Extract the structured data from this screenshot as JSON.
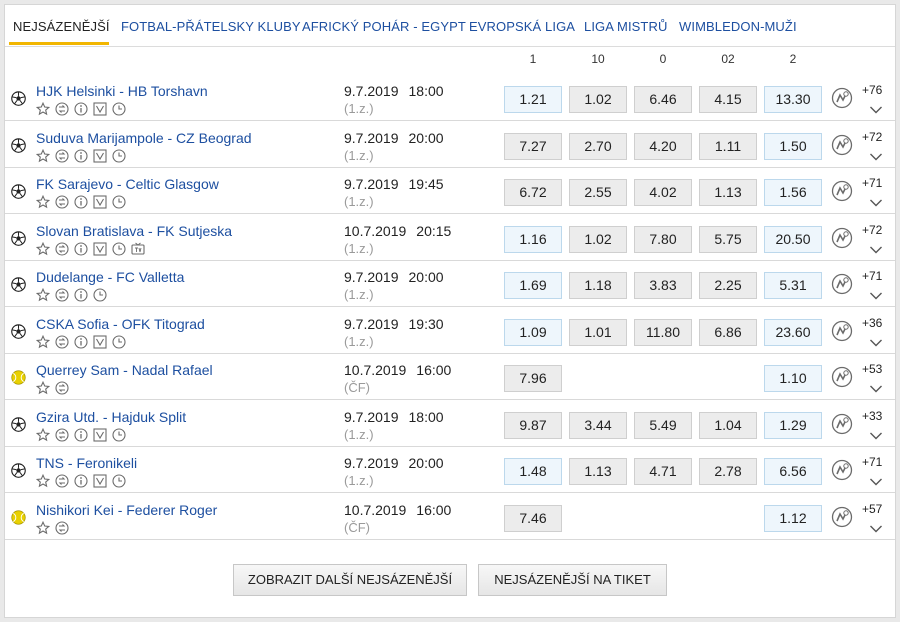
{
  "tabs": [
    "NEJSÁZENĚJŠÍ",
    "FOTBAL-PŘÁTELSKY KLUBY",
    "AFRICKÝ POHÁR - EGYPT",
    "EVROPSKÁ LIGA",
    "LIGA MISTRŮ",
    "WIMBLEDON-MUŽI"
  ],
  "columns": [
    "1",
    "10",
    "0",
    "02",
    "2"
  ],
  "colors": {
    "link": "#1d4fa0",
    "accent": "#f2b600",
    "odd_highlight": "#eef6fc",
    "odd_bg": "#ececec",
    "tennis_ball": "#e8d000"
  },
  "matches": [
    {
      "sport": "football",
      "name": "HJK Helsinki - HB Torshavn",
      "date": "9.7.2019",
      "time": "18:00",
      "round": "(1.z.)",
      "icons": [
        "star-icon",
        "replay-icon",
        "info-icon",
        "chart-icon",
        "clock-icon"
      ],
      "odds": [
        "1.21",
        "1.02",
        "6.46",
        "4.15",
        "13.30"
      ],
      "highlight": [
        true,
        false,
        false,
        false,
        true
      ],
      "more": "+76"
    },
    {
      "sport": "football",
      "name": "Suduva Marijampole - CZ Beograd",
      "date": "9.7.2019",
      "time": "20:00",
      "round": "(1.z.)",
      "icons": [
        "star-icon",
        "replay-icon",
        "info-icon",
        "chart-icon",
        "clock-icon"
      ],
      "odds": [
        "7.27",
        "2.70",
        "4.20",
        "1.11",
        "1.50"
      ],
      "highlight": [
        false,
        false,
        false,
        false,
        true
      ],
      "more": "+72"
    },
    {
      "sport": "football",
      "name": "FK Sarajevo - Celtic Glasgow",
      "date": "9.7.2019",
      "time": "19:45",
      "round": "(1.z.)",
      "icons": [
        "star-icon",
        "replay-icon",
        "info-icon",
        "chart-icon",
        "clock-icon"
      ],
      "odds": [
        "6.72",
        "2.55",
        "4.02",
        "1.13",
        "1.56"
      ],
      "highlight": [
        false,
        false,
        false,
        false,
        true
      ],
      "more": "+71"
    },
    {
      "sport": "football",
      "name": "Slovan Bratislava - FK Sutjeska",
      "date": "10.7.2019",
      "time": "20:15",
      "round": "(1.z.)",
      "icons": [
        "star-icon",
        "replay-icon",
        "info-icon",
        "chart-icon",
        "clock-icon",
        "tv-icon"
      ],
      "odds": [
        "1.16",
        "1.02",
        "7.80",
        "5.75",
        "20.50"
      ],
      "highlight": [
        true,
        false,
        false,
        false,
        true
      ],
      "more": "+72"
    },
    {
      "sport": "football",
      "name": "Dudelange - FC Valletta",
      "date": "9.7.2019",
      "time": "20:00",
      "round": "(1.z.)",
      "icons": [
        "star-icon",
        "replay-icon",
        "info-icon",
        "clock-icon"
      ],
      "odds": [
        "1.69",
        "1.18",
        "3.83",
        "2.25",
        "5.31"
      ],
      "highlight": [
        true,
        false,
        false,
        false,
        true
      ],
      "more": "+71"
    },
    {
      "sport": "football",
      "name": "CSKA Sofia - OFK Titograd",
      "date": "9.7.2019",
      "time": "19:30",
      "round": "(1.z.)",
      "icons": [
        "star-icon",
        "replay-icon",
        "info-icon",
        "chart-icon",
        "clock-icon"
      ],
      "odds": [
        "1.09",
        "1.01",
        "11.80",
        "6.86",
        "23.60"
      ],
      "highlight": [
        true,
        false,
        false,
        false,
        true
      ],
      "more": "+36"
    },
    {
      "sport": "tennis",
      "name": "Querrey Sam - Nadal Rafael",
      "date": "10.7.2019",
      "time": "16:00",
      "round": "(ČF)",
      "icons": [
        "star-icon",
        "replay-icon"
      ],
      "odds": [
        "7.96",
        "",
        "",
        "",
        "1.10"
      ],
      "highlight": [
        false,
        false,
        false,
        false,
        true
      ],
      "more": "+53"
    },
    {
      "sport": "football",
      "name": "Gzira Utd. - Hajduk Split",
      "date": "9.7.2019",
      "time": "18:00",
      "round": "(1.z.)",
      "icons": [
        "star-icon",
        "replay-icon",
        "info-icon",
        "chart-icon",
        "clock-icon"
      ],
      "odds": [
        "9.87",
        "3.44",
        "5.49",
        "1.04",
        "1.29"
      ],
      "highlight": [
        false,
        false,
        false,
        false,
        true
      ],
      "more": "+33"
    },
    {
      "sport": "football",
      "name": "TNS - Feronikeli",
      "date": "9.7.2019",
      "time": "20:00",
      "round": "(1.z.)",
      "icons": [
        "star-icon",
        "replay-icon",
        "info-icon",
        "chart-icon",
        "clock-icon"
      ],
      "odds": [
        "1.48",
        "1.13",
        "4.71",
        "2.78",
        "6.56"
      ],
      "highlight": [
        true,
        false,
        false,
        false,
        true
      ],
      "more": "+71"
    },
    {
      "sport": "tennis",
      "name": "Nishikori Kei - Federer Roger",
      "date": "10.7.2019",
      "time": "16:00",
      "round": "(ČF)",
      "icons": [
        "star-icon",
        "replay-icon"
      ],
      "odds": [
        "7.46",
        "",
        "",
        "",
        "1.12"
      ],
      "highlight": [
        false,
        false,
        false,
        false,
        true
      ],
      "more": "+57"
    }
  ],
  "buttons": {
    "show_more": "ZOBRAZIT DALŠÍ NEJSÁZENĚJŠÍ",
    "to_ticket": "NEJSÁZENĚJŠÍ NA TIKET"
  }
}
